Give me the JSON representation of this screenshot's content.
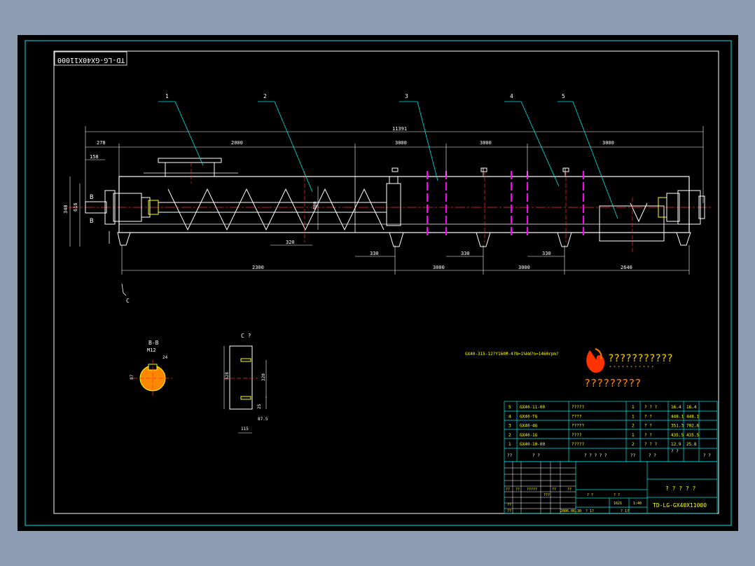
{
  "drawing": {
    "code_mirrored": "TD-LG-GX40X11000",
    "title_code": "TD-LG-GX40X11000",
    "spec_note": "GX40-315-12?Y160M-4?N=1%kW?n=1460rpm?",
    "company_garbled": "???????????",
    "company_sub": "* * * * * * * * * * *",
    "company_cn": "?????????",
    "drawing_name": "? ? ? ? ?",
    "quantity_header": "? ? ? ? ?"
  },
  "callouts": [
    "1",
    "2",
    "3",
    "4",
    "5"
  ],
  "dimensions": {
    "overall": "11391",
    "top_segments": [
      "278",
      "2000",
      "3000",
      "3000",
      "3000"
    ],
    "left_offset": "158",
    "pitch": "320",
    "diameter": "400",
    "height_outer": "340",
    "height_inner": "616",
    "support_spacings": [
      "330",
      "330",
      "330"
    ],
    "bottom_segments": [
      "2300",
      "3000",
      "3000",
      "2640"
    ],
    "section_B_label": "B",
    "section_C_label": "C"
  },
  "section_bb": {
    "title": "B-B",
    "subtitle": "M12",
    "key_width": "24",
    "diameter": "87"
  },
  "detail_c": {
    "title": "C ?",
    "height": "528",
    "slot_len": "320",
    "gap": "25",
    "offset": "87.5",
    "width": "115"
  },
  "bom": [
    {
      "no": "5",
      "code": "GX40-11-00",
      "name": "?????",
      "qty": "1",
      "mat": "? ? ?",
      "w1": "16.4",
      "w2": "16.4"
    },
    {
      "no": "4",
      "code": "GX40-TG",
      "name": "????",
      "qty": "1",
      "mat": "?  ?",
      "w1": "448.1",
      "w2": "448.1"
    },
    {
      "no": "3",
      "code": "GX40-4G",
      "name": "?????",
      "qty": "2",
      "mat": "?  ?",
      "w1": "351.3",
      "w2": "702.6"
    },
    {
      "no": "2",
      "code": "GX40-1G",
      "name": "????",
      "qty": "1",
      "mat": "?  ?",
      "w1": "435.5",
      "w2": "435.5"
    },
    {
      "no": "1",
      "code": "GX40-10-00",
      "name": "?????",
      "qty": "2",
      "mat": "? ? ?",
      "w1": "12.9",
      "w2": "25.8"
    }
  ],
  "bom_header": {
    "no": "??",
    "code": "? ?",
    "name": "? ? ? ? ?",
    "qty": "??",
    "mat": "? ?",
    "w": "? ?",
    "rem": "? ?"
  },
  "titleblock": {
    "weight": "1621",
    "scale": "1:40",
    "date": "2006.06.30",
    "cells": [
      "??",
      "??",
      "?????",
      "??",
      "??",
      "???",
      "? ?",
      "? ?",
      "??",
      "??",
      "?  1?",
      "?  1?"
    ]
  }
}
